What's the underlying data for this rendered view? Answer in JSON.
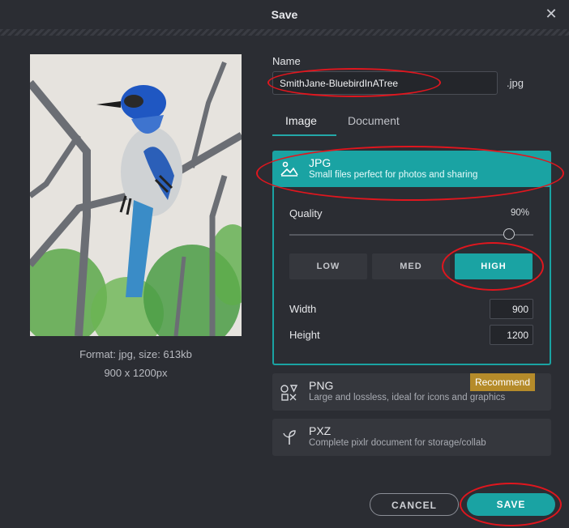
{
  "dialog": {
    "title": "Save",
    "close_icon": "close-icon"
  },
  "preview": {
    "format_text": "Format: jpg, size: 613kb",
    "dimensions_text": "900 x 1200px"
  },
  "form": {
    "name_label": "Name",
    "name_value": "SmithJane-BluebirdInATree",
    "extension": ".jpg",
    "tabs": [
      {
        "label": "Image",
        "active": true
      },
      {
        "label": "Document",
        "active": false
      }
    ]
  },
  "formats": {
    "jpg": {
      "title": "JPG",
      "subtitle": "Small files perfect for photos and sharing",
      "selected": true,
      "icon": "image-landscape-icon"
    },
    "png": {
      "title": "PNG",
      "subtitle": "Large and lossless, ideal for icons and graphics",
      "badge": "Recommend",
      "icon": "shapes-icon"
    },
    "pxz": {
      "title": "PXZ",
      "subtitle": "Complete pixlr document for storage/collab",
      "icon": "pixlr-sprout-icon"
    }
  },
  "jpg_settings": {
    "quality_label": "Quality",
    "quality_value": "90%",
    "quality_level": 0.9,
    "presets": [
      "LOW",
      "MED",
      "HIGH"
    ],
    "active_preset": "HIGH",
    "width_label": "Width",
    "width_value": "900",
    "height_label": "Height",
    "height_value": "1200"
  },
  "actions": {
    "cancel_label": "CANCEL",
    "save_label": "SAVE"
  },
  "colors": {
    "accent": "#1aa3a3",
    "background": "#2b2d33",
    "badge": "#b58b2a",
    "annotation": "#e0161e"
  }
}
